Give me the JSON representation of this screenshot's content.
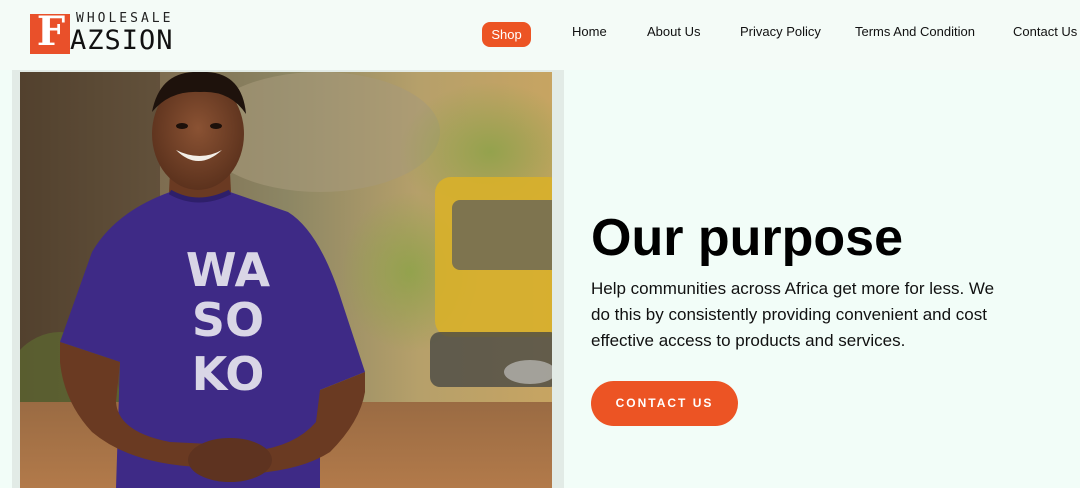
{
  "brand": {
    "logo_letter": "F",
    "logo_top": "WHOLESALE",
    "logo_main": "AZSION",
    "accent_color": "#ec5424"
  },
  "nav": {
    "shop": "Shop",
    "home": "Home",
    "about": "About Us",
    "privacy": "Privacy Policy",
    "terms": "Terms And Condition",
    "contact": "Contact Us"
  },
  "hero": {
    "title": "Our purpose",
    "description": "Help communities across Africa get more for less. We do this by consistently providing convenient and cost effective access to products and services.",
    "cta_label": "CONTACT US"
  },
  "photo": {
    "shirt_text": [
      "WA",
      "SO",
      "KO"
    ]
  }
}
